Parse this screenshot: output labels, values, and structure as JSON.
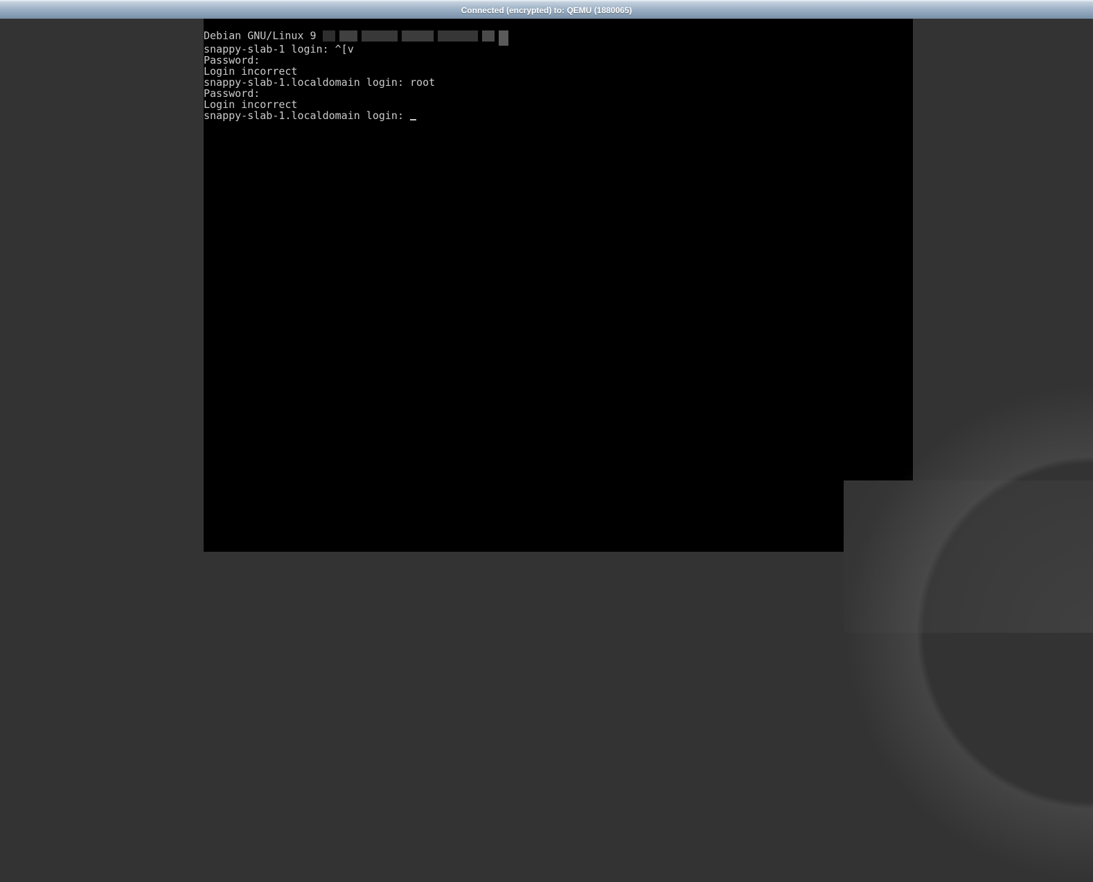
{
  "header": {
    "status_text": "Connected (encrypted) to: QEMU (1880065)"
  },
  "console": {
    "lines": [
      "Debian GNU/Linux 9 ",
      "",
      "snappy-slab-1 login: ^[v",
      "Password:",
      "",
      "Login incorrect",
      "snappy-slab-1.localdomain login: root",
      "Password:",
      "",
      "Login incorrect",
      "snappy-slab-1.localdomain login: "
    ],
    "cursor_char": "_"
  }
}
